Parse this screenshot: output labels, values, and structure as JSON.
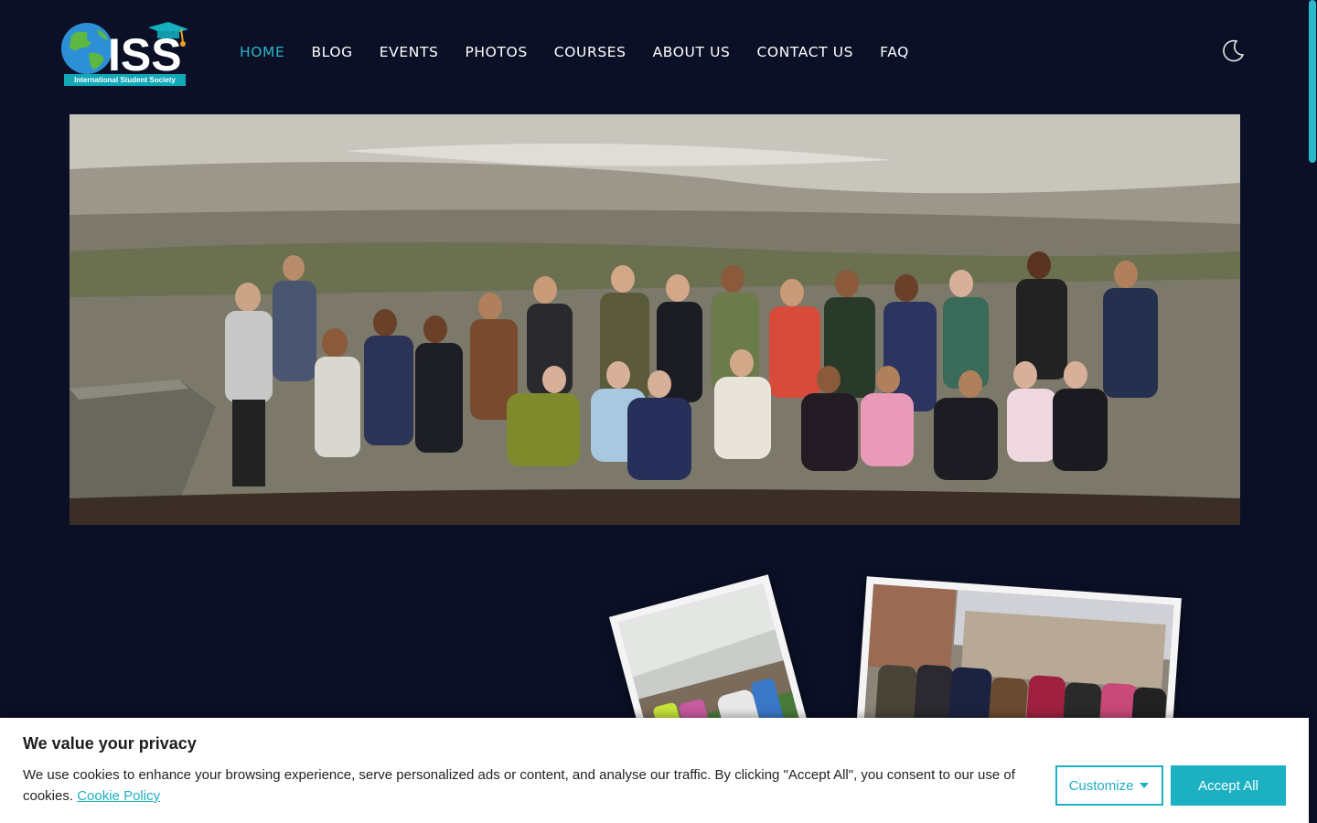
{
  "header": {
    "logo_text": "ISS",
    "logo_caption": "International Student Society",
    "nav": [
      {
        "label": "HOME",
        "active": true
      },
      {
        "label": "BLOG",
        "active": false
      },
      {
        "label": "EVENTS",
        "active": false
      },
      {
        "label": "PHOTOS",
        "active": false
      },
      {
        "label": "COURSES",
        "active": false
      },
      {
        "label": "ABOUT US",
        "active": false
      },
      {
        "label": "CONTACT US",
        "active": false
      },
      {
        "label": "FAQ",
        "active": false
      }
    ],
    "theme_toggle_icon": "moon-icon"
  },
  "colors": {
    "background": "#0b1027",
    "accent": "#29b6c8",
    "banner_bg": "#ffffff",
    "button_primary": "#1cb0c3"
  },
  "hero": {
    "image": "group-photo-on-beach"
  },
  "gallery": [
    {
      "image": "students-outdoor-activity"
    },
    {
      "image": "students-group-in-city"
    }
  ],
  "cookie_banner": {
    "title": "We value your privacy",
    "text": "We use cookies to enhance your browsing experience, serve personalized ads or content, and analyse our traffic. By clicking \"Accept All\", you consent to our use of cookies.",
    "policy_link": "Cookie Policy",
    "customize_label": "Customize",
    "accept_label": "Accept All"
  }
}
